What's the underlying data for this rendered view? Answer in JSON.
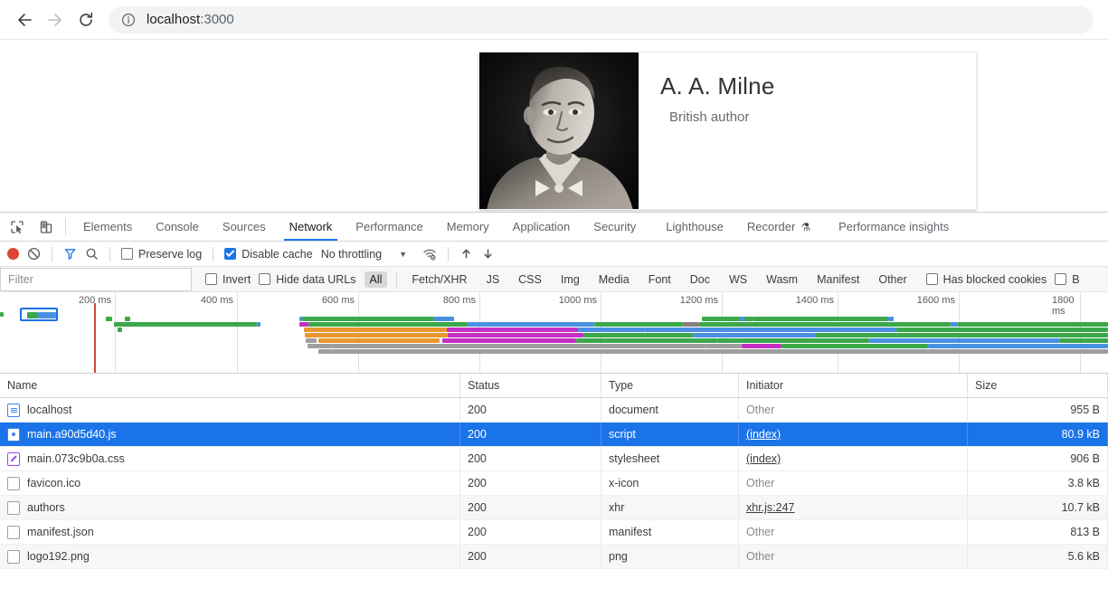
{
  "browser": {
    "back_icon": "arrow-left-icon",
    "forward_icon": "arrow-right-icon",
    "reload_icon": "reload-icon",
    "site_info_icon": "info-circle-icon",
    "url_host": "localhost",
    "url_port": ":3000"
  },
  "page": {
    "author_name": "A. A. Milne",
    "author_role": "British author",
    "photo_alt": "portrait-photo"
  },
  "devtools": {
    "inspect_icon": "inspect-element-icon",
    "device_icon": "device-toolbar-icon",
    "tabs": [
      {
        "label": "Elements",
        "active": false
      },
      {
        "label": "Console",
        "active": false
      },
      {
        "label": "Sources",
        "active": false
      },
      {
        "label": "Network",
        "active": true
      },
      {
        "label": "Performance",
        "active": false
      },
      {
        "label": "Memory",
        "active": false
      },
      {
        "label": "Application",
        "active": false
      },
      {
        "label": "Security",
        "active": false
      },
      {
        "label": "Lighthouse",
        "active": false
      },
      {
        "label": "Recorder",
        "active": false,
        "badge": "⚗"
      },
      {
        "label": "Performance insights",
        "active": false
      }
    ],
    "toolbar": {
      "record_icon": "record-circle-icon",
      "clear_icon": "clear-prohibited-icon",
      "filter_icon": "funnel-icon",
      "search_icon": "search-icon",
      "preserve_log_label": "Preserve log",
      "preserve_log_checked": false,
      "disable_cache_label": "Disable cache",
      "disable_cache_checked": true,
      "throttling_value": "No throttling",
      "throttle_caret_icon": "chevron-down-icon",
      "network_conditions_icon": "wifi-settings-icon",
      "import_icon": "upload-arrow-icon",
      "export_icon": "download-arrow-icon"
    },
    "filterbar": {
      "filter_placeholder": "Filter",
      "invert_label": "Invert",
      "invert_checked": false,
      "hide_data_urls_label": "Hide data URLs",
      "hide_data_urls_checked": false,
      "types": [
        "All",
        "Fetch/XHR",
        "JS",
        "CSS",
        "Img",
        "Media",
        "Font",
        "Doc",
        "WS",
        "Wasm",
        "Manifest",
        "Other"
      ],
      "selected_type": "All",
      "has_blocked_cookies_label": "Has blocked cookies",
      "has_blocked_cookies_checked": false,
      "blocked_requests_label": "B",
      "blocked_requests_checked": false
    },
    "timeline": {
      "ticks": [
        "200 ms",
        "400 ms",
        "600 ms",
        "800 ms",
        "1000 ms",
        "1200 ms",
        "1400 ms",
        "1600 ms",
        "1800 ms"
      ]
    },
    "table": {
      "columns": [
        "Name",
        "Status",
        "Type",
        "Initiator",
        "Size"
      ],
      "rows": [
        {
          "name": "localhost",
          "icon": "document-file-icon",
          "status": "200",
          "type": "document",
          "initiator": "Other",
          "initiator_link": false,
          "size": "955 B",
          "selected": false
        },
        {
          "name": "main.a90d5d40.js",
          "icon": "script-file-icon",
          "status": "200",
          "type": "script",
          "initiator": "(index)",
          "initiator_link": true,
          "size": "80.9 kB",
          "selected": true
        },
        {
          "name": "main.073c9b0a.css",
          "icon": "stylesheet-file-icon",
          "status": "200",
          "type": "stylesheet",
          "initiator": "(index)",
          "initiator_link": true,
          "size": "906 B",
          "selected": false
        },
        {
          "name": "favicon.ico",
          "icon": "generic-file-icon",
          "status": "200",
          "type": "x-icon",
          "initiator": "Other",
          "initiator_link": false,
          "size": "3.8 kB",
          "selected": false
        },
        {
          "name": "authors",
          "icon": "generic-file-icon",
          "status": "200",
          "type": "xhr",
          "initiator": "xhr.js:247",
          "initiator_link": true,
          "size": "10.7 kB",
          "selected": false
        },
        {
          "name": "manifest.json",
          "icon": "generic-file-icon",
          "status": "200",
          "type": "manifest",
          "initiator": "Other",
          "initiator_link": false,
          "size": "813 B",
          "selected": false
        },
        {
          "name": "logo192.png",
          "icon": "generic-file-icon",
          "status": "200",
          "type": "png",
          "initiator": "Other",
          "initiator_link": false,
          "size": "5.6 kB",
          "selected": false
        }
      ]
    },
    "colors": {
      "accent": "#1a73e8",
      "record": "#db4437",
      "green": "#3ba84a",
      "blue": "#4a90e2",
      "orange": "#e8972e",
      "magenta": "#c42fc4",
      "grey": "#9e9e9e",
      "purple": "#a142f4"
    }
  }
}
